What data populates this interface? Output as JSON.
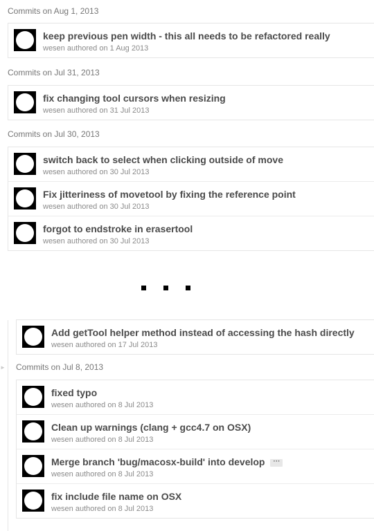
{
  "groups": [
    {
      "header": "Commits on Aug 1, 2013",
      "commits": [
        {
          "title": "keep previous pen width - this all needs to be refactored really",
          "meta": "wesen authored on 1 Aug 2013"
        }
      ]
    },
    {
      "header": "Commits on Jul 31, 2013",
      "commits": [
        {
          "title": "fix changing tool cursors when resizing",
          "meta": "wesen authored on 31 Jul 2013"
        }
      ]
    },
    {
      "header": "Commits on Jul 30, 2013",
      "commits": [
        {
          "title": "switch back to select when clicking outside of move",
          "meta": "wesen authored on 30 Jul 2013"
        },
        {
          "title": "Fix jitteriness of movetool by fixing the reference point",
          "meta": "wesen authored on 30 Jul 2013"
        },
        {
          "title": "forgot to endstroke in erasertool",
          "meta": "wesen authored on 30 Jul 2013"
        }
      ]
    }
  ],
  "continued": {
    "commits": [
      {
        "title": "Add getTool helper method instead of accessing the hash directly",
        "meta": "wesen authored on 17 Jul 2013"
      }
    ]
  },
  "lower_group": {
    "header_prefix": "Commits",
    "header_suffix": " on Jul 8, 2013",
    "commits": [
      {
        "title": "fixed typo",
        "meta": "wesen authored on 8 Jul 2013"
      },
      {
        "title": "Clean up warnings (clang + gcc4.7 on OSX)",
        "meta": "wesen authored on 8 Jul 2013"
      },
      {
        "title": "Merge branch 'bug/macosx-build' into develop",
        "meta": "wesen authored on 8 Jul 2013",
        "ellipsis": "···"
      },
      {
        "title": "fix include file name on OSX",
        "meta": "wesen authored on 8 Jul 2013"
      }
    ]
  },
  "icons": [
    "avatar-icon",
    "ellipsis-icon",
    "timeline-arrow-icon"
  ]
}
